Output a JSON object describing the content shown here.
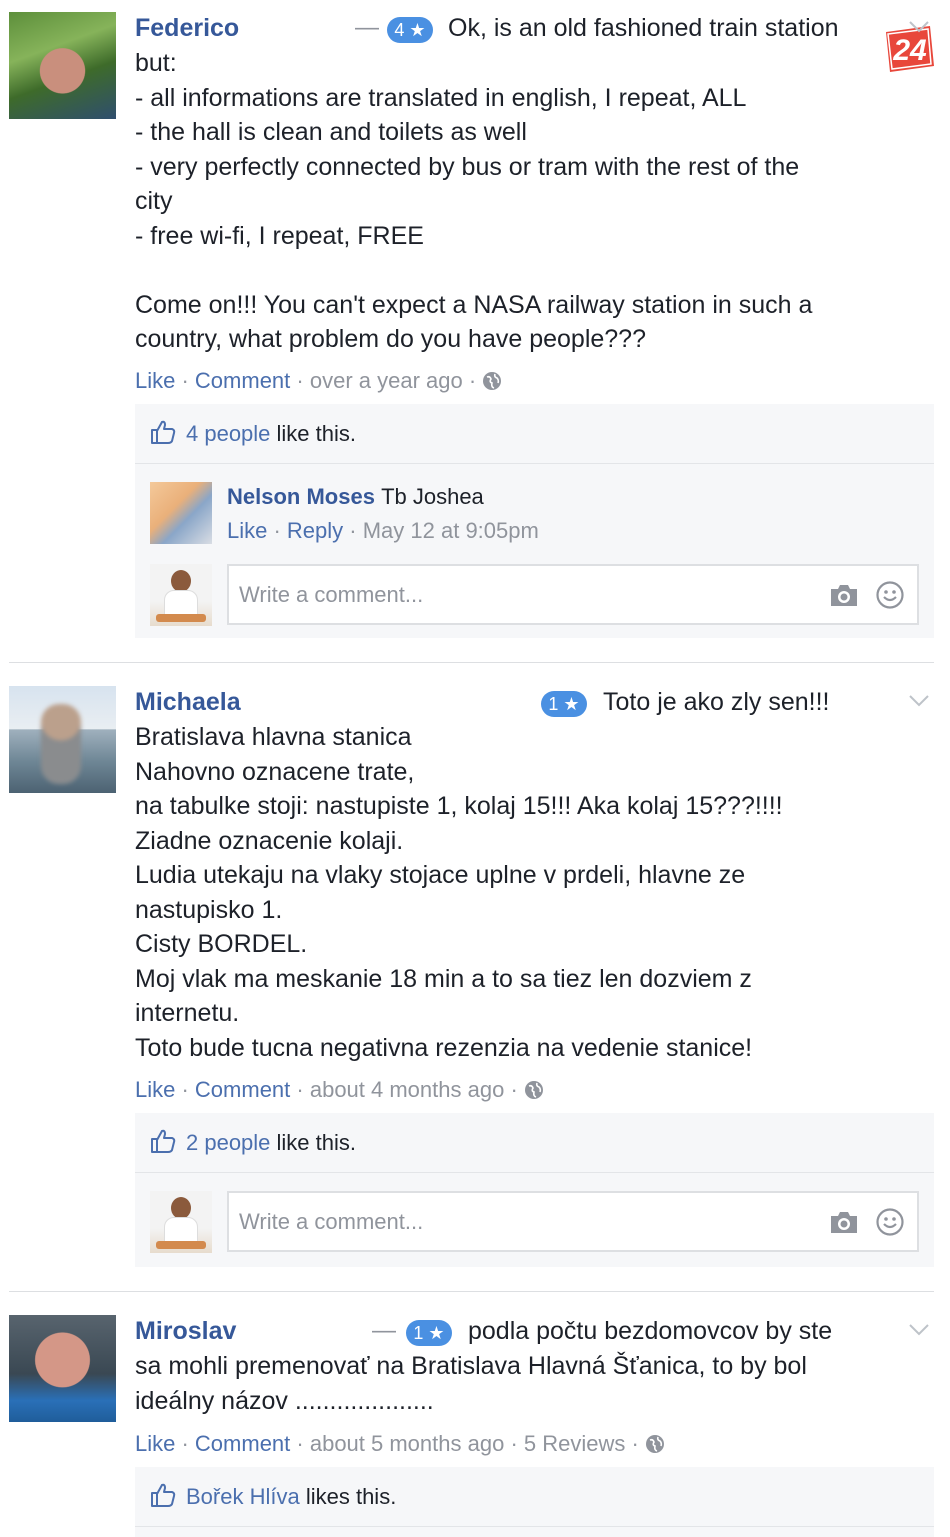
{
  "brand": {
    "logo_text": "24",
    "logo_color": "#e8473b"
  },
  "colors": {
    "link": "#365899",
    "badge": "#4a90e2",
    "muted": "#90949c"
  },
  "common": {
    "like_label": "Like",
    "comment_label": "Comment",
    "reply_label": "Reply",
    "separator": " · ",
    "write_placeholder": "Write a comment...",
    "like_this": " like this.",
    "likes_this": " likes this."
  },
  "reviews": [
    {
      "author": "Federico",
      "rating": "4 ★",
      "first_line": "Ok, is an old fashioned train station",
      "body": "but:\n- all informations are translated in english, I repeat, ALL\n- the hall is clean and toilets as well\n- very perfectly connected by bus or tram with the rest of the\ncity\n- free wi-fi, I repeat, FREE\n\nCome on!!! You can't expect a NASA railway station in such a\ncountry, what problem do you have people???",
      "time": "over a year ago",
      "likes_link": "4 people",
      "replies": [
        {
          "author": "Nelson Moses",
          "text": "Tb Joshea",
          "time": "May 12 at 9:05pm"
        }
      ]
    },
    {
      "author": "Michaela",
      "rating": "1 ★",
      "first_line": "Toto je ako zly sen!!!",
      "body": "Bratislava hlavna stanica\nNahovno oznacene trate,\nna tabulke stoji: nastupiste 1, kolaj 15!!! Aka kolaj 15???!!!!\nZiadne oznacenie kolaji.\nLudia utekaju na vlaky stojace uplne v prdeli, hlavne ze\nnastupisko 1.\nCisty BORDEL.\nMoj vlak ma meskanie 18 min a to sa tiez len dozviem z\ninternetu.\nToto bude tucna negativna rezenzia na vedenie stanice!",
      "time": "about 4 months ago",
      "likes_link": "2 people"
    },
    {
      "author": "Miroslav",
      "rating": "1 ★",
      "first_line": "podla počtu bezdomovcov by ste",
      "body": "sa mohli premenovať na Bratislava Hlavná Šťanica, to by bol\nideálny názov ....................",
      "time": "about 5 months ago",
      "reviews_count": "5 Reviews",
      "likes_link": "Bořek Hlíva"
    }
  ]
}
